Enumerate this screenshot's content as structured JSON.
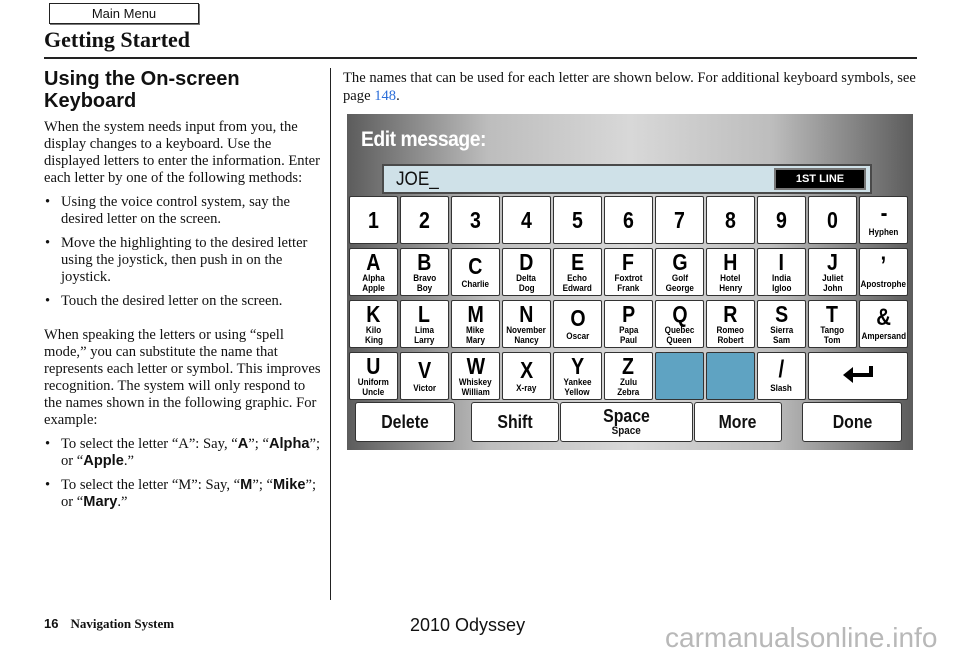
{
  "nav": {
    "main_menu_label": "Main Menu"
  },
  "section": {
    "title": "Getting Started"
  },
  "left": {
    "heading": "Using the On-screen Keyboard",
    "intro": "When the system needs input from you, the display changes to a keyboard. Use the displayed letters to enter the information. Enter each letter by one of the following methods:",
    "methods": [
      "Using the voice control system, say the desired letter on the screen.",
      "Move the highlighting to the desired letter using the joystick, then push in on the joystick.",
      "Touch the desired letter on the screen."
    ],
    "spell_paragraph": "When speaking the letters or using “spell mode,” you can substitute the name that represents each letter or symbol. This improves recognition. The system will only respond to the names shown in the following graphic. For example:",
    "examples": [
      {
        "prefix": "To select the letter “A”: Say, “",
        "letter": "A",
        "mid1": "”; “",
        "name1": "Alpha",
        "mid2": "”; or “",
        "name2": "Apple",
        "suffix": ".”"
      },
      {
        "prefix": "To select the letter “M”: Say, “",
        "letter": "M",
        "mid1": "”; “",
        "name1": "Mike",
        "mid2": "”; or “",
        "name2": "Mary",
        "suffix": ".”"
      }
    ]
  },
  "right": {
    "intro_text": "The names that can be used for each letter are shown below. For additional keyboard symbols, see page ",
    "page_ref": "148",
    "intro_end": "."
  },
  "keyboard": {
    "title": "Edit message:",
    "input_value": "JOE_",
    "line_button": "1ST LINE",
    "highlight_color": "#5fa3c2",
    "rows": [
      [
        {
          "main": "1",
          "sub": ""
        },
        {
          "main": "2",
          "sub": ""
        },
        {
          "main": "3",
          "sub": ""
        },
        {
          "main": "4",
          "sub": ""
        },
        {
          "main": "5",
          "sub": ""
        },
        {
          "main": "6",
          "sub": ""
        },
        {
          "main": "7",
          "sub": ""
        },
        {
          "main": "8",
          "sub": ""
        },
        {
          "main": "9",
          "sub": ""
        },
        {
          "main": "0",
          "sub": ""
        },
        {
          "main": "-",
          "sub": "Hyphen"
        }
      ],
      [
        {
          "main": "A",
          "sub": "Alpha\nApple"
        },
        {
          "main": "B",
          "sub": "Bravo\nBoy"
        },
        {
          "main": "C",
          "sub": "Charlie"
        },
        {
          "main": "D",
          "sub": "Delta\nDog"
        },
        {
          "main": "E",
          "sub": "Echo\nEdward"
        },
        {
          "main": "F",
          "sub": "Foxtrot\nFrank"
        },
        {
          "main": "G",
          "sub": "Golf\nGeorge"
        },
        {
          "main": "H",
          "sub": "Hotel\nHenry"
        },
        {
          "main": "I",
          "sub": "India\nIgloo"
        },
        {
          "main": "J",
          "sub": "Juliet\nJohn"
        },
        {
          "main": "’",
          "sub": "Apostrophe"
        }
      ],
      [
        {
          "main": "K",
          "sub": "Kilo\nKing"
        },
        {
          "main": "L",
          "sub": "Lima\nLarry"
        },
        {
          "main": "M",
          "sub": "Mike\nMary"
        },
        {
          "main": "N",
          "sub": "November\nNancy"
        },
        {
          "main": "O",
          "sub": "Oscar"
        },
        {
          "main": "P",
          "sub": "Papa\nPaul"
        },
        {
          "main": "Q",
          "sub": "Quebec\nQueen"
        },
        {
          "main": "R",
          "sub": "Romeo\nRobert"
        },
        {
          "main": "S",
          "sub": "Sierra\nSam"
        },
        {
          "main": "T",
          "sub": "Tango\nTom"
        },
        {
          "main": "&",
          "sub": "Ampersand"
        }
      ],
      [
        {
          "main": "U",
          "sub": "Uniform\nUncle"
        },
        {
          "main": "V",
          "sub": "Victor"
        },
        {
          "main": "W",
          "sub": "Whiskey\nWilliam"
        },
        {
          "main": "X",
          "sub": "X-ray"
        },
        {
          "main": "Y",
          "sub": "Yankee\nYellow"
        },
        {
          "main": "Z",
          "sub": "Zulu\nZebra"
        },
        {
          "main": "",
          "sub": "",
          "blank": true
        },
        {
          "main": "",
          "sub": "",
          "blank": true
        },
        {
          "main": "/",
          "sub": "Slash"
        },
        {
          "main": "",
          "sub": "",
          "enter": true,
          "icon": "enter-arrow-icon"
        }
      ]
    ],
    "functions": {
      "delete": "Delete",
      "shift": "Shift",
      "space": "Space",
      "space_sub": "Space",
      "more": "More",
      "done": "Done"
    }
  },
  "footer": {
    "page_number": "16",
    "book": "Navigation System",
    "model": "2010 Odyssey",
    "watermark": "carmanualsonline.info"
  }
}
